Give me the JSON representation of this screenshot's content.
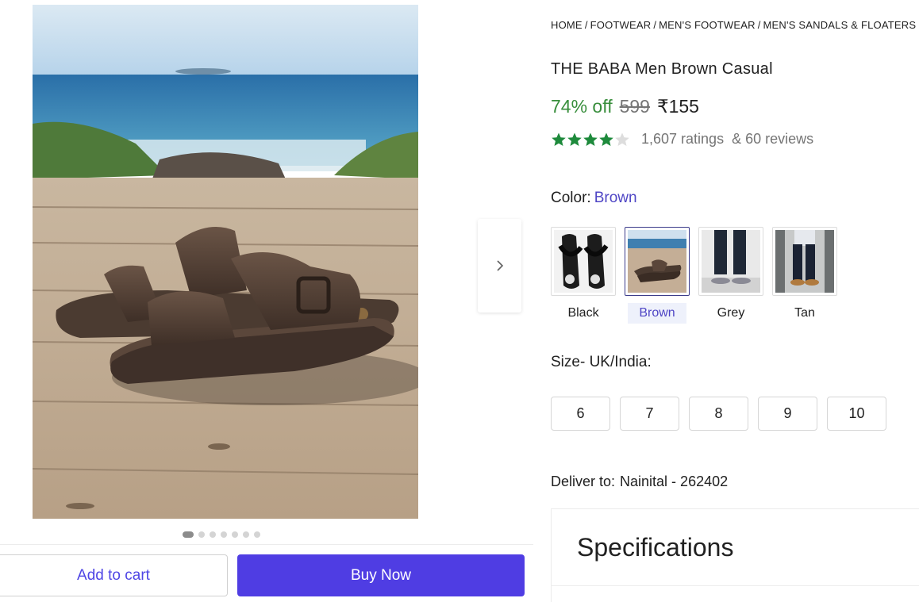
{
  "breadcrumb": {
    "items": [
      "HOME",
      "FOOTWEAR",
      "MEN'S FOOTWEAR",
      "MEN'S SANDALS & FLOATERS"
    ],
    "separator": "/"
  },
  "product": {
    "title": "THE BABA Men Brown Casual",
    "discount": "74% off",
    "mrp": "599",
    "price": "₹155",
    "rating": {
      "stars_filled": 4,
      "stars_total": 5,
      "ratings_text": "1,607 ratings",
      "reviews_text": "& 60 reviews"
    }
  },
  "gallery": {
    "dot_count": 7,
    "active_dot": 0
  },
  "color": {
    "label": "Color:",
    "selected": "Brown",
    "options": [
      {
        "name": "Black"
      },
      {
        "name": "Brown"
      },
      {
        "name": "Grey"
      },
      {
        "name": "Tan"
      }
    ]
  },
  "size": {
    "label": "Size- UK/India:",
    "options": [
      "6",
      "7",
      "8",
      "9",
      "10"
    ]
  },
  "delivery": {
    "label": "Deliver to:",
    "location": "Nainital - 262402"
  },
  "specifications": {
    "title": "Specifications"
  },
  "actions": {
    "add_to_cart": "Add to cart",
    "buy_now": "Buy Now"
  },
  "colors": {
    "accent": "#4f3de3",
    "discount_green": "#388e3c",
    "star_green": "#1e8a3c",
    "link_purple": "#4f46c5"
  },
  "icons": {
    "next": "chevron-right-icon",
    "star": "star-icon"
  }
}
